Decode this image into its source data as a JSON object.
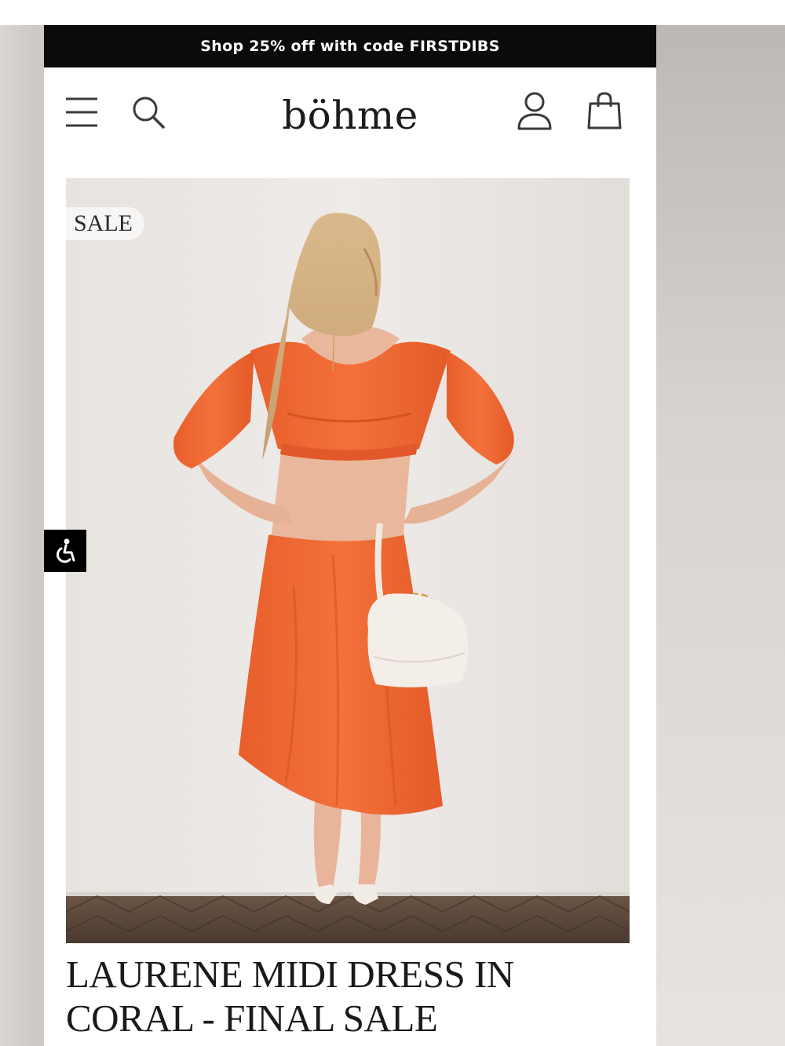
{
  "promo": {
    "text": "Shop 25% off with code FIRSTDIBS"
  },
  "header": {
    "brand": "böhme",
    "icons": {
      "menu": "menu-icon",
      "search": "search-icon",
      "account": "account-icon",
      "cart": "shopping-bag-icon"
    }
  },
  "product": {
    "badge": "SALE",
    "image": "model-back-view-coral-cutout-dress",
    "title_line1": "LAURENE MIDI DRESS IN",
    "title_line2": "CORAL - FINAL SALE"
  },
  "accessibility": {
    "icon": "accessibility-icon"
  },
  "colors": {
    "promo_bg": "#0b0b0b",
    "dress": "#f06a35",
    "text": "#1a1a1a"
  }
}
